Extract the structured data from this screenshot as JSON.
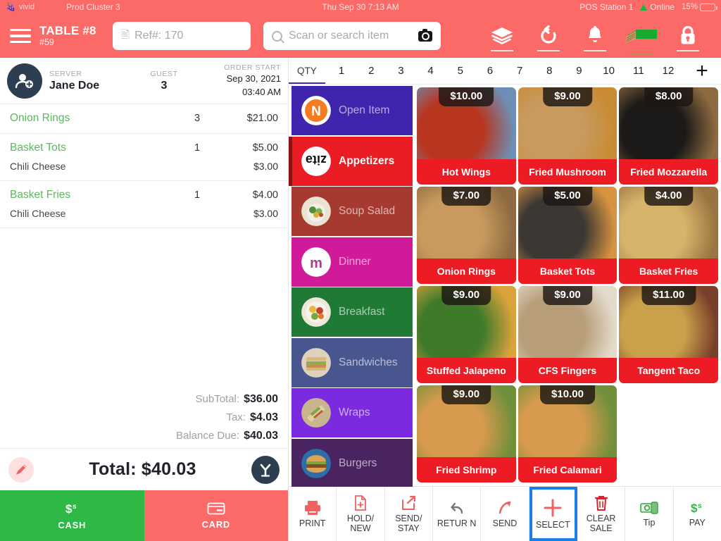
{
  "statusbar": {
    "brand": "vivid",
    "cluster": "Prod Cluster 3",
    "datetime": "Thu Sep 30 7:13 AM",
    "station": "POS Station 1",
    "connection": "Online",
    "battery": "15%",
    "battery_level": 15,
    "accent": "#fc6a68"
  },
  "header": {
    "table_title": "TABLE #8",
    "table_sub": "#59",
    "ref_value": "Ref#: 170",
    "search_placeholder": "Scan or search item",
    "icons": [
      "layers-icon",
      "refresh-icon",
      "bell-icon",
      "cash-drawer-icon",
      "lock-icon"
    ]
  },
  "order": {
    "server_label": "SERVER",
    "server_name": "Jane Doe",
    "guest_label": "GUEST",
    "guest_count": "3",
    "start_label": "ORDER START",
    "start_date": "Sep 30, 2021",
    "start_time": "03:40 AM",
    "items": [
      {
        "name": "Onion Rings",
        "qty": "3",
        "price": "$21.00",
        "modifier": null,
        "modifier_price": null
      },
      {
        "name": "Basket Tots",
        "qty": "1",
        "price": "$5.00",
        "modifier": "Chili Cheese",
        "modifier_price": "$3.00"
      },
      {
        "name": "Basket Fries",
        "qty": "1",
        "price": "$4.00",
        "modifier": "Chili Cheese",
        "modifier_price": "$3.00"
      }
    ],
    "totals": [
      {
        "label": "SubTotal:",
        "value": "$36.00"
      },
      {
        "label": "Tax:",
        "value": "$4.03"
      },
      {
        "label": "Balance Due:",
        "value": "$40.03"
      }
    ],
    "grand_total": "Total: $40.03",
    "cash_label": "CASH",
    "card_label": "CARD"
  },
  "qty": {
    "label": "QTY",
    "values": [
      "1",
      "2",
      "3",
      "4",
      "5",
      "6",
      "7",
      "8",
      "9",
      "10",
      "11",
      "12"
    ],
    "selected": "1"
  },
  "categories": [
    {
      "label": "Open Item",
      "color": "#3f25ad",
      "icon": "open-item-icon",
      "active": false
    },
    {
      "label": "Appetizers",
      "color": "#ec1c24",
      "icon": "appetizers-icon",
      "active": true
    },
    {
      "label": "Soup Salad",
      "color": "#a73a30",
      "icon": "soup-salad-icon",
      "active": false
    },
    {
      "label": "Dinner",
      "color": "#d01a9a",
      "icon": "dinner-icon",
      "active": false
    },
    {
      "label": "Breakfast",
      "color": "#1f7a36",
      "icon": "breakfast-icon",
      "active": false
    },
    {
      "label": "Sandwiches",
      "color": "#48558f",
      "icon": "sandwiches-icon",
      "active": false
    },
    {
      "label": "Wraps",
      "color": "#7b2ae0",
      "icon": "wraps-icon",
      "active": false
    },
    {
      "label": "Burgers",
      "color": "#4a2460",
      "icon": "burgers-icon",
      "active": false
    }
  ],
  "products": [
    {
      "name": "Hot Wings",
      "price": "$10.00",
      "img_a": "#b8361f",
      "img_b": "#6d8fb5"
    },
    {
      "name": "Fried Mushroom",
      "price": "$9.00",
      "img_a": "#e0a council",
      "img_b": "#c98b32"
    },
    {
      "name": "Fried Mozzarella",
      "price": "$8.00",
      "img_a": "#1c1a18",
      "img_b": "#d9a busy"
    },
    {
      "name": "Onion Rings",
      "price": "$7.00",
      "img_a": "#c89a5e",
      "img_b": "#8d6a40"
    },
    {
      "name": "Basket Tots",
      "price": "$5.00",
      "img_a": "#3b3733",
      "img_b": "#d79340"
    },
    {
      "name": "Basket Fries",
      "price": "$4.00",
      "img_a": "#d8b36a",
      "img_b": "#9a7440"
    },
    {
      "name": "Stuffed Jalapeno",
      "price": "$9.00",
      "img_a": "#3f7a2a",
      "img_b": "#dca33c"
    },
    {
      "name": "CFS Fingers",
      "price": "$9.00",
      "img_a": "#b79d78",
      "img_b": "#e3dacb"
    },
    {
      "name": "Tangent Taco",
      "price": "$11.00",
      "img_a": "#c9a14a",
      "img_b": "#7a3f2a"
    },
    {
      "name": "Fried Shrimp",
      "price": "$9.00",
      "img_a": "#d79a4e",
      "img_b": "#6f8f3a"
    },
    {
      "name": "Fried Calamari",
      "price": "$10.00",
      "img_a": "#d79a4e",
      "img_b": "#6f8f3a"
    }
  ],
  "toolbar": [
    {
      "label": "PRINT",
      "icon": "printer-icon",
      "selected": false
    },
    {
      "label": "HOLD/ NEW",
      "icon": "hold-new-icon",
      "selected": false
    },
    {
      "label": "SEND/ STAY",
      "icon": "send-stay-icon",
      "selected": false
    },
    {
      "label": "RETUR N",
      "icon": "return-icon",
      "selected": false
    },
    {
      "label": "SEND",
      "icon": "send-icon",
      "selected": false
    },
    {
      "label": "SELECT",
      "icon": "plus-icon",
      "selected": true
    },
    {
      "label": "CLEAR SALE",
      "icon": "trash-icon",
      "selected": false
    },
    {
      "label": "Tip",
      "icon": "tip-icon",
      "selected": false
    },
    {
      "label": "PAY",
      "icon": "pay-icon",
      "selected": false
    }
  ]
}
